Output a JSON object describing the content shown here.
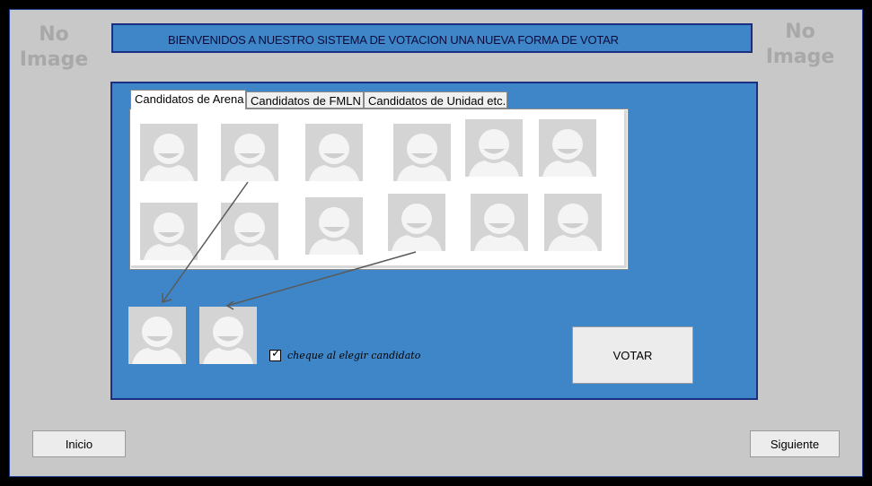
{
  "header": {
    "left_placeholder": [
      "No",
      "Image"
    ],
    "right_placeholder": [
      "No",
      "Image"
    ],
    "banner_text": "BIENVENIDOS A NUESTRO SISTEMA DE VOTACION UNA NUEVA FORMA DE VOTAR"
  },
  "tabs": [
    {
      "label": "Candidatos de Arena",
      "active": true
    },
    {
      "label": "Candidatos de FMLN",
      "active": false
    },
    {
      "label": "Candidatos de Unidad etc.",
      "active": false
    }
  ],
  "candidate_grid": {
    "rows": 2,
    "columns": 6,
    "avatar_icon": "user-placeholder-icon"
  },
  "selected_candidates": {
    "count": 2,
    "avatar_icon": "user-placeholder-icon"
  },
  "checkbox": {
    "label": "cheque al elegir candidato",
    "checked": true
  },
  "buttons": {
    "vote": "VOTAR",
    "home": "Inicio",
    "next": "Siguiente"
  },
  "colors": {
    "panel_blue": "#3f86c8",
    "panel_border": "#1b2f80",
    "window_bg": "#c8c8c8",
    "placeholder_gray": "#d4d4d4"
  }
}
